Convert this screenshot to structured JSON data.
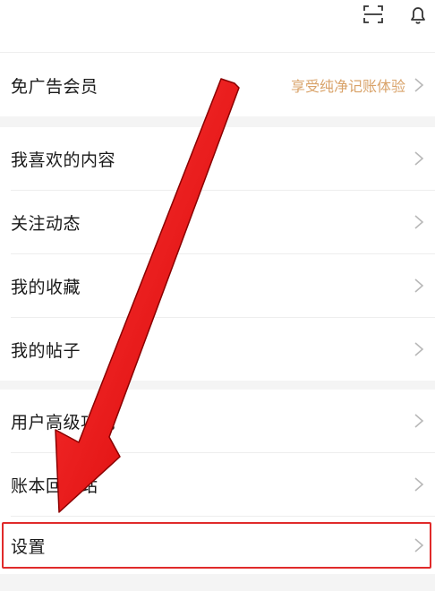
{
  "menu": {
    "vip": {
      "label": "免广告会员",
      "promo": "享受纯净记账体验"
    },
    "group1": [
      {
        "label": "我喜欢的内容"
      },
      {
        "label": "关注动态"
      },
      {
        "label": "我的收藏"
      },
      {
        "label": "我的帖子"
      }
    ],
    "group2": [
      {
        "label": "用户高级功能"
      },
      {
        "label": "账本回收站"
      },
      {
        "label": "设置"
      }
    ]
  },
  "icons": {
    "scan": "scan-icon",
    "notification": "bell-icon",
    "chevron": "chevron-right-icon"
  },
  "colors": {
    "promo_text": "#d9a36a",
    "annotation": "#e02a2a",
    "section_gap": "#f4f4f4"
  }
}
